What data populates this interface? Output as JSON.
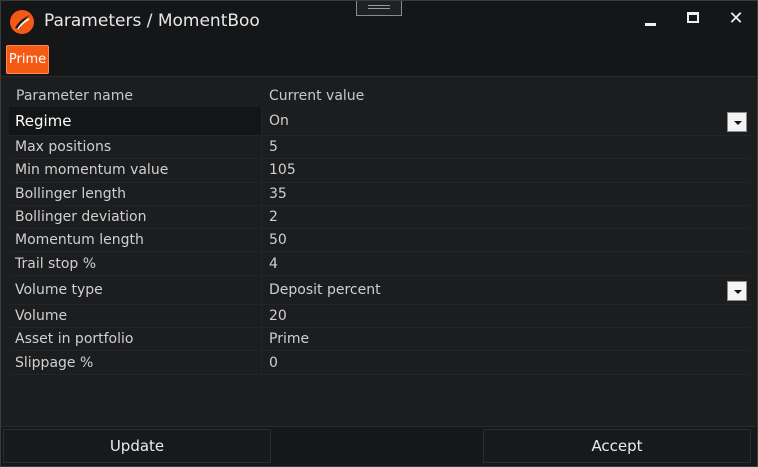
{
  "window": {
    "title": "Parameters / MomentBoo",
    "close_glyph": "✕"
  },
  "tabs": [
    {
      "label": "Prime",
      "active": true
    }
  ],
  "grid": {
    "header_name": "Parameter name",
    "header_value": "Current value",
    "rows": [
      {
        "name": "Regime",
        "value": "On",
        "dropdown": true
      },
      {
        "name": "Max positions",
        "value": "5"
      },
      {
        "name": "Min momentum value",
        "value": "105"
      },
      {
        "name": "Bollinger length",
        "value": "35"
      },
      {
        "name": "Bollinger deviation",
        "value": "2"
      },
      {
        "name": "Momentum length",
        "value": "50"
      },
      {
        "name": "Trail stop %",
        "value": "4"
      },
      {
        "name": "Volume type",
        "value": "Deposit percent",
        "dropdown": true
      },
      {
        "name": "Volume",
        "value": "20"
      },
      {
        "name": "Asset in portfolio",
        "value": "Prime"
      },
      {
        "name": "Slippage %",
        "value": "0"
      }
    ]
  },
  "footer": {
    "update_label": "Update",
    "accept_label": "Accept"
  },
  "colors": {
    "accent": "#f55a14",
    "background": "#1c1d1f",
    "titlebar": "#151618"
  }
}
